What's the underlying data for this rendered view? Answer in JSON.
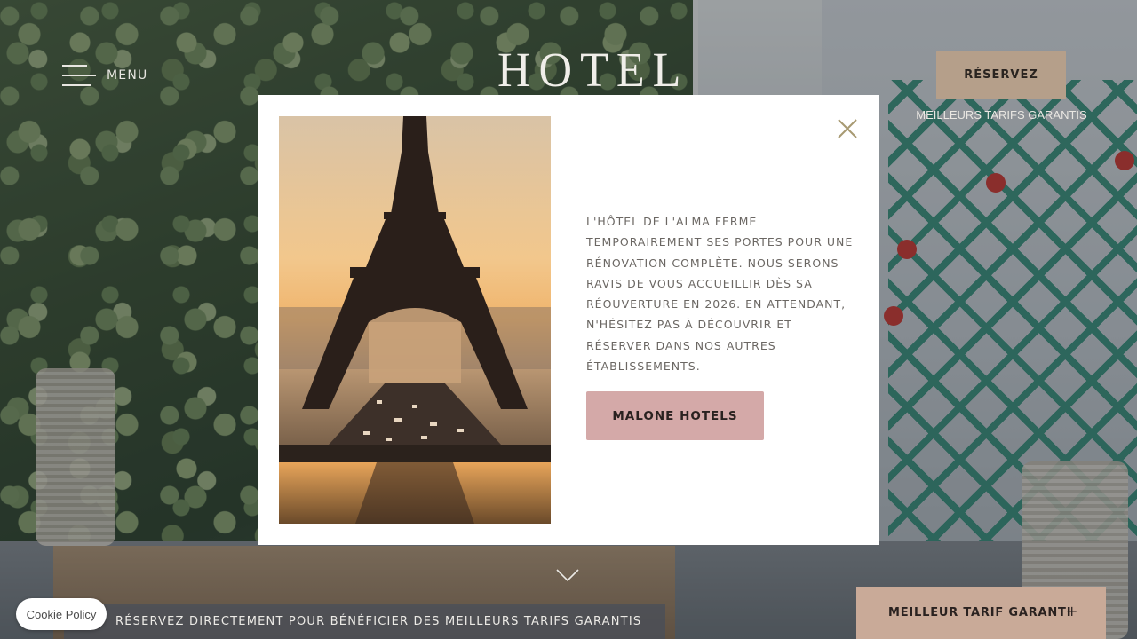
{
  "header": {
    "menu_label": "MENU",
    "logo_text": "HOTEL",
    "reserve_label": "RÉSERVEZ",
    "best_rates_label": "MEILLEURS TARIFS GARANTIS"
  },
  "modal": {
    "message": "L'HÔTEL DE L'ALMA FERME TEMPORAIREMENT SES PORTES POUR UNE RÉNOVATION COMPLÈTE. NOUS SERONS RAVIS DE VOUS ACCUEILLIR DÈS SA RÉOUVERTURE EN 2026. EN ATTENDANT, N'HÉSITEZ PAS À DÉCOUVRIR ET RÉSERVER DANS NOS AUTRES ÉTABLISSEMENTS.",
    "cta_label": "MALONE HOTELS",
    "photo_icon": "eiffel-tower-photo",
    "close_icon": "close-icon"
  },
  "footer": {
    "promo_text": "RÉSERVEZ DIRECTEMENT POUR BÉNÉFICIER DES MEILLEURS TARIFS GARANTIS",
    "cookie_label": "Cookie Policy",
    "best_tariff_label": "MEILLEUR TARIF GARANTI",
    "best_tariff_toggle": "+"
  },
  "colors": {
    "reserve_bg": "#b59f8a",
    "cta_bg": "#d4a9a8",
    "tariff_bg": "#c9aa98",
    "close_icon": "#a89a72"
  }
}
